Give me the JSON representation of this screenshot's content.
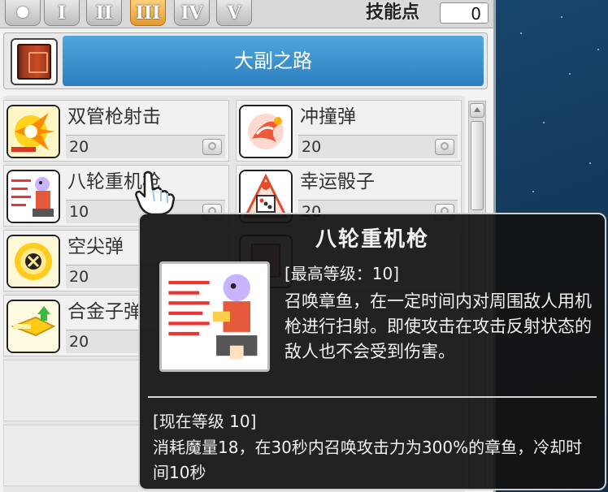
{
  "window": {
    "tabs": [
      {
        "label": "",
        "icon": "circle-icon"
      },
      {
        "label": "I"
      },
      {
        "label": "II"
      },
      {
        "label": "III",
        "active": true
      },
      {
        "label": "IV"
      },
      {
        "label": "V"
      }
    ],
    "skill_point_label": "技能点",
    "skill_point_value": "0",
    "job_name": "大副之路"
  },
  "skills": [
    {
      "name": "双管枪射击",
      "level": "20"
    },
    {
      "name": "冲撞弹",
      "level": "20"
    },
    {
      "name": "八轮重机枪",
      "level": "10"
    },
    {
      "name": "幸运骰子",
      "level": "20"
    },
    {
      "name": "空尖弹",
      "level": "20"
    },
    {
      "name": "合金子弹",
      "level": "20"
    }
  ],
  "tooltip": {
    "title": "八轮重机枪",
    "max_level": "[最高等级：10]",
    "description": "召唤章鱼，在一定时间内对周围敌人用机枪进行扫射。即使攻击在攻击反射状态的敌人也不会受到伤害。",
    "current_level": "[现在等级 10]",
    "effect": "消耗魔量18，在30秒内召唤攻击力为300%的章鱼，冷却时间10秒"
  },
  "colors": {
    "job_bar": "#3a90cf",
    "active_tab": "#f0a93e",
    "tooltip_bg": "#141414"
  }
}
